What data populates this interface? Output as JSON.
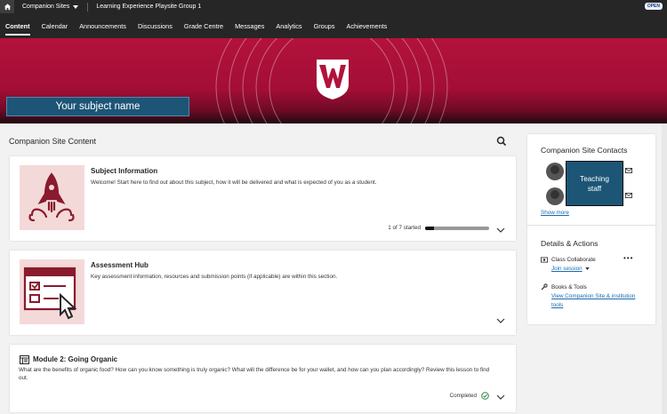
{
  "topbar": {
    "site_switcher": "Companion Sites",
    "group_name": "Learning Experience Playsite Group 1",
    "badge": "OPEN"
  },
  "nav": {
    "tabs": [
      {
        "label": "Content",
        "active": true
      },
      {
        "label": "Calendar"
      },
      {
        "label": "Announcements"
      },
      {
        "label": "Discussions"
      },
      {
        "label": "Grade Centre"
      },
      {
        "label": "Messages"
      },
      {
        "label": "Analytics"
      },
      {
        "label": "Groups"
      },
      {
        "label": "Achievements"
      }
    ]
  },
  "banner": {
    "subject_name": "Your subject name",
    "logo_letter": "W"
  },
  "main": {
    "title": "Companion Site Content",
    "cards": [
      {
        "title": "Subject Information",
        "description": "Welcome! Start here to find out about this subject, how it will be delivered and what is expected of you as a student.",
        "progress_text": "1 of 7 started",
        "progress": 0.14
      },
      {
        "title": "Assessment Hub",
        "description": "Key assessment information, resources and submission points (if applicable) are within this section."
      },
      {
        "title": "Module 2: Going Organic",
        "description": "What are the benefits of organic food? How can you know something is truly organic? What will the difference be for your wallet, and how can you plan accordingly? Review this lesson to find out.",
        "status": "Completed"
      }
    ]
  },
  "sidebar": {
    "contacts_title": "Companion Site Contacts",
    "teaching_staff": "Teaching staff",
    "show_more": "Show more",
    "details_title": "Details & Actions",
    "class_collaborate": "Class Collaborate",
    "join_session": "Join session",
    "books_tools": "Books & Tools",
    "companion_tools": "View Companion Site & institution tools"
  },
  "colors": {
    "brand": "#b3123c",
    "accent": "#1c5576",
    "link": "#1a6bb0",
    "success": "#2e8540"
  }
}
